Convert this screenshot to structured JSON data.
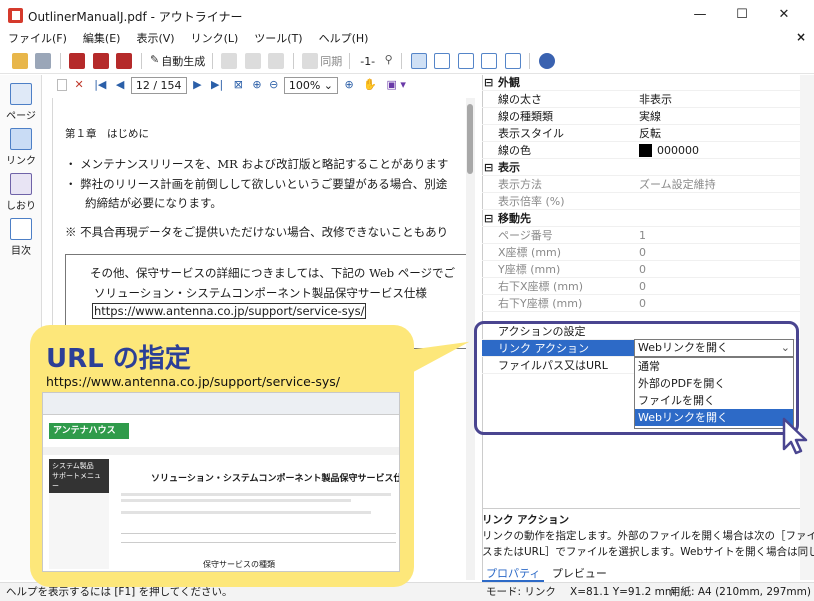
{
  "window": {
    "title": "OutlinerManualJ.pdf - アウトライナー",
    "minimize": "—",
    "maximize": "☐",
    "close": "✕"
  },
  "menu": [
    "ファイル(F)",
    "編集(E)",
    "表示(V)",
    "リンク(L)",
    "ツール(T)",
    "ヘルプ(H)"
  ],
  "menu_close": "×",
  "toolbar": {
    "auto_generate": "自動生成",
    "sync": "同期",
    "level": "-1-"
  },
  "nav_toolbar": {
    "page_current": "12 / 154",
    "zoom": "100%"
  },
  "left_nav": [
    {
      "label": "ページ"
    },
    {
      "label": "リンク"
    },
    {
      "label": "しおり"
    },
    {
      "label": "目次"
    }
  ],
  "document": {
    "chapter": "第１章　はじめに",
    "bullet1": "・ メンテナンスリリースを、MR および改訂版と略記することがあります",
    "bullet2": "・ 弊社のリリース計画を前倒しして欲しいというご要望がある場合、別途",
    "bullet2b": "約締結が必要になります。",
    "note": "※ 不具合再現データをご提供いただけない場合、改修できないこともあり",
    "box_line1": "その他、保守サービスの詳細につきましては、下記の Web ページでご",
    "box_line2": "ソリューション・システムコンポーネント製品保守サービス仕様",
    "box_link": "https://www.antenna.co.jp/support/service-sys/"
  },
  "properties": {
    "cat_appearance": "外観",
    "line_width": {
      "name": "線の太さ",
      "value": "非表示"
    },
    "line_type": {
      "name": "線の種類類",
      "value": "実線"
    },
    "display_style": {
      "name": "表示スタイル",
      "value": "反転"
    },
    "line_color": {
      "name": "線の色",
      "value": "000000"
    },
    "cat_display": "表示",
    "display_method": {
      "name": "表示方法",
      "value": "ズーム設定維持"
    },
    "display_ratio": {
      "name": "表示倍率 (%)",
      "value": ""
    },
    "cat_destination": "移動先",
    "page_number": {
      "name": "ページ番号",
      "value": "1"
    },
    "x_coord": {
      "name": "X座標 (mm)",
      "value": "0"
    },
    "y_coord": {
      "name": "Y座標 (mm)",
      "value": "0"
    },
    "rb_x": {
      "name": "右下X座標 (mm)",
      "value": "0"
    },
    "rb_y": {
      "name": "右下Y座標 (mm)",
      "value": "0"
    },
    "action_settings": {
      "name": "アクションの設定",
      "value": ""
    },
    "link_action": {
      "name": "リンク アクション",
      "value": "Webリンクを開く"
    },
    "file_path": {
      "name": "ファイルパス又はURL",
      "value": ""
    }
  },
  "dropdown_options": [
    "通常",
    "外部のPDFを開く",
    "ファイルを開く",
    "Webリンクを開く"
  ],
  "description": {
    "title": "リンク アクション",
    "body_line1": "リンクの動作を指定します。外部のファイルを開く場合は次の［ファイルパ",
    "body_line2": "スまたはURL］でファイルを選択します。Webサイトを開く場合は同じく次"
  },
  "bottom_tabs": [
    "プロパティ",
    "プレビュー"
  ],
  "status": {
    "left": "ヘルプを表示するには [F1] を押してください。",
    "mode": "モード: リンク",
    "coords": "X=81.1 Y=91.2 mm",
    "paper": "用紙: A4 (210mm, 297mm)"
  },
  "callout": {
    "title": "URL の指定",
    "url": "https://www.antenna.co.jp/support/service-sys/"
  },
  "webshot": {
    "brand": "アンテナハウス",
    "heading": "ソリューション・システムコンポーネント製品保守サービス仕様",
    "side_title": "システム製品",
    "side_sub": "サポートメニュー",
    "footer_heading": "保守サービスの種類"
  },
  "colors": {
    "accent": "#2d6ac7",
    "callout_bg": "#fde77a",
    "callout_title": "#2c3f97",
    "highlight": "#4a4590"
  }
}
